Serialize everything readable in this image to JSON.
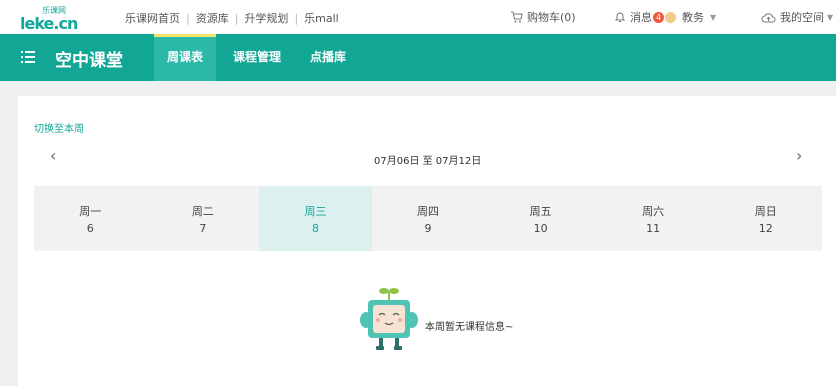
{
  "topbar": {
    "logo_main": "leke.cn",
    "logo_sub": "乐课网",
    "links": [
      "乐课网首页",
      "资源库",
      "升学规划",
      "乐mall"
    ],
    "cart": "购物车(0)",
    "messages": "消息",
    "message_count": "4",
    "user": "教务",
    "space": "我的空间"
  },
  "nav": {
    "brand": "空中课堂",
    "tabs": [
      "周课表",
      "课程管理",
      "点播库"
    ],
    "active_tab": 0
  },
  "schedule": {
    "switch_label": "切换至本周",
    "prev_arrow": "‹",
    "next_arrow": "›",
    "range": "07月06日 至 07月12日",
    "days": [
      {
        "name": "周一",
        "date": "6"
      },
      {
        "name": "周二",
        "date": "7"
      },
      {
        "name": "周三",
        "date": "8"
      },
      {
        "name": "周四",
        "date": "9"
      },
      {
        "name": "周五",
        "date": "10"
      },
      {
        "name": "周六",
        "date": "11"
      },
      {
        "name": "周日",
        "date": "12"
      }
    ],
    "active_day": 2,
    "empty_message": "本周暂无课程信息~"
  },
  "colors": {
    "brand": "#12a695",
    "active_tab_indicator": "#f5e36b",
    "badge": "#f05a3c"
  }
}
